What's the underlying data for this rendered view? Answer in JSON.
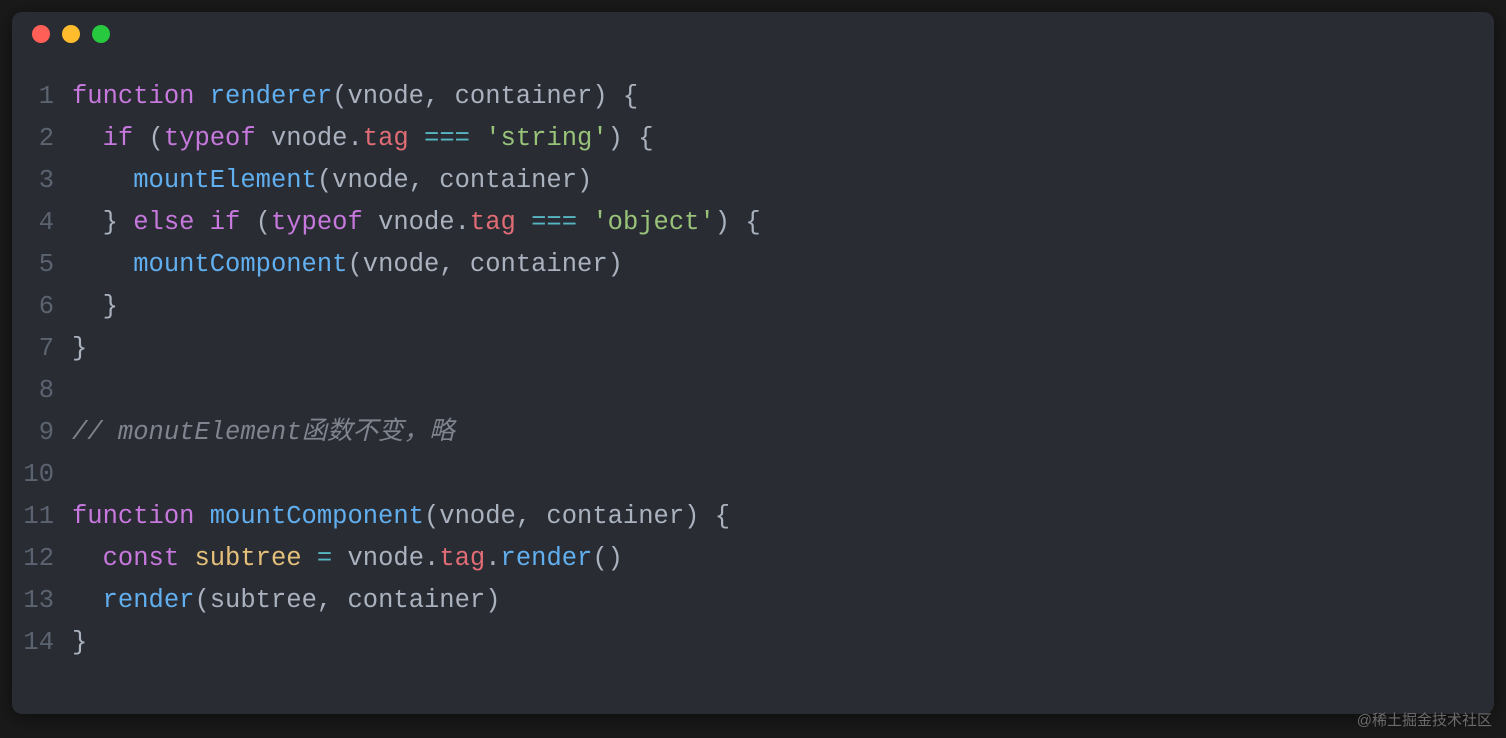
{
  "watermark": "@稀土掘金技术社区",
  "traffic_lights": [
    "red",
    "yellow",
    "green"
  ],
  "lines": [
    {
      "n": "1",
      "tokens": [
        {
          "t": "function ",
          "c": "kw"
        },
        {
          "t": "renderer",
          "c": "fn"
        },
        {
          "t": "(",
          "c": "punct"
        },
        {
          "t": "vnode",
          "c": "param"
        },
        {
          "t": ", ",
          "c": "punct"
        },
        {
          "t": "container",
          "c": "param"
        },
        {
          "t": ") {",
          "c": "punct"
        }
      ]
    },
    {
      "n": "2",
      "tokens": [
        {
          "t": "  ",
          "c": "plain"
        },
        {
          "t": "if ",
          "c": "kw"
        },
        {
          "t": "(",
          "c": "punct"
        },
        {
          "t": "typeof ",
          "c": "kw"
        },
        {
          "t": "vnode",
          "c": "param"
        },
        {
          "t": ".",
          "c": "punct"
        },
        {
          "t": "tag",
          "c": "prop"
        },
        {
          "t": " === ",
          "c": "op"
        },
        {
          "t": "'string'",
          "c": "str"
        },
        {
          "t": ") {",
          "c": "punct"
        }
      ]
    },
    {
      "n": "3",
      "tokens": [
        {
          "t": "    ",
          "c": "plain"
        },
        {
          "t": "mountElement",
          "c": "fn"
        },
        {
          "t": "(",
          "c": "punct"
        },
        {
          "t": "vnode",
          "c": "param"
        },
        {
          "t": ", ",
          "c": "punct"
        },
        {
          "t": "container",
          "c": "param"
        },
        {
          "t": ")",
          "c": "punct"
        }
      ]
    },
    {
      "n": "4",
      "tokens": [
        {
          "t": "  } ",
          "c": "punct"
        },
        {
          "t": "else if ",
          "c": "kw"
        },
        {
          "t": "(",
          "c": "punct"
        },
        {
          "t": "typeof ",
          "c": "kw"
        },
        {
          "t": "vnode",
          "c": "param"
        },
        {
          "t": ".",
          "c": "punct"
        },
        {
          "t": "tag",
          "c": "prop"
        },
        {
          "t": " === ",
          "c": "op"
        },
        {
          "t": "'object'",
          "c": "str"
        },
        {
          "t": ") {",
          "c": "punct"
        }
      ]
    },
    {
      "n": "5",
      "tokens": [
        {
          "t": "    ",
          "c": "plain"
        },
        {
          "t": "mountComponent",
          "c": "fn"
        },
        {
          "t": "(",
          "c": "punct"
        },
        {
          "t": "vnode",
          "c": "param"
        },
        {
          "t": ", ",
          "c": "punct"
        },
        {
          "t": "container",
          "c": "param"
        },
        {
          "t": ")",
          "c": "punct"
        }
      ]
    },
    {
      "n": "6",
      "tokens": [
        {
          "t": "  }",
          "c": "punct"
        }
      ]
    },
    {
      "n": "7",
      "tokens": [
        {
          "t": "}",
          "c": "punct"
        }
      ]
    },
    {
      "n": "8",
      "tokens": []
    },
    {
      "n": "9",
      "tokens": [
        {
          "t": "// monutElement函数不变，略",
          "c": "comment"
        }
      ]
    },
    {
      "n": "10",
      "tokens": []
    },
    {
      "n": "11",
      "tokens": [
        {
          "t": "function ",
          "c": "kw"
        },
        {
          "t": "mountComponent",
          "c": "fn"
        },
        {
          "t": "(",
          "c": "punct"
        },
        {
          "t": "vnode",
          "c": "param"
        },
        {
          "t": ", ",
          "c": "punct"
        },
        {
          "t": "container",
          "c": "param"
        },
        {
          "t": ") {",
          "c": "punct"
        }
      ]
    },
    {
      "n": "12",
      "tokens": [
        {
          "t": "  ",
          "c": "plain"
        },
        {
          "t": "const ",
          "c": "kw"
        },
        {
          "t": "subtree",
          "c": "ident"
        },
        {
          "t": " = ",
          "c": "op"
        },
        {
          "t": "vnode",
          "c": "param"
        },
        {
          "t": ".",
          "c": "punct"
        },
        {
          "t": "tag",
          "c": "prop"
        },
        {
          "t": ".",
          "c": "punct"
        },
        {
          "t": "render",
          "c": "fn"
        },
        {
          "t": "()",
          "c": "punct"
        }
      ]
    },
    {
      "n": "13",
      "tokens": [
        {
          "t": "  ",
          "c": "plain"
        },
        {
          "t": "render",
          "c": "fn"
        },
        {
          "t": "(",
          "c": "punct"
        },
        {
          "t": "subtree",
          "c": "param"
        },
        {
          "t": ", ",
          "c": "punct"
        },
        {
          "t": "container",
          "c": "param"
        },
        {
          "t": ")",
          "c": "punct"
        }
      ]
    },
    {
      "n": "14",
      "tokens": [
        {
          "t": "}",
          "c": "punct"
        }
      ]
    }
  ]
}
